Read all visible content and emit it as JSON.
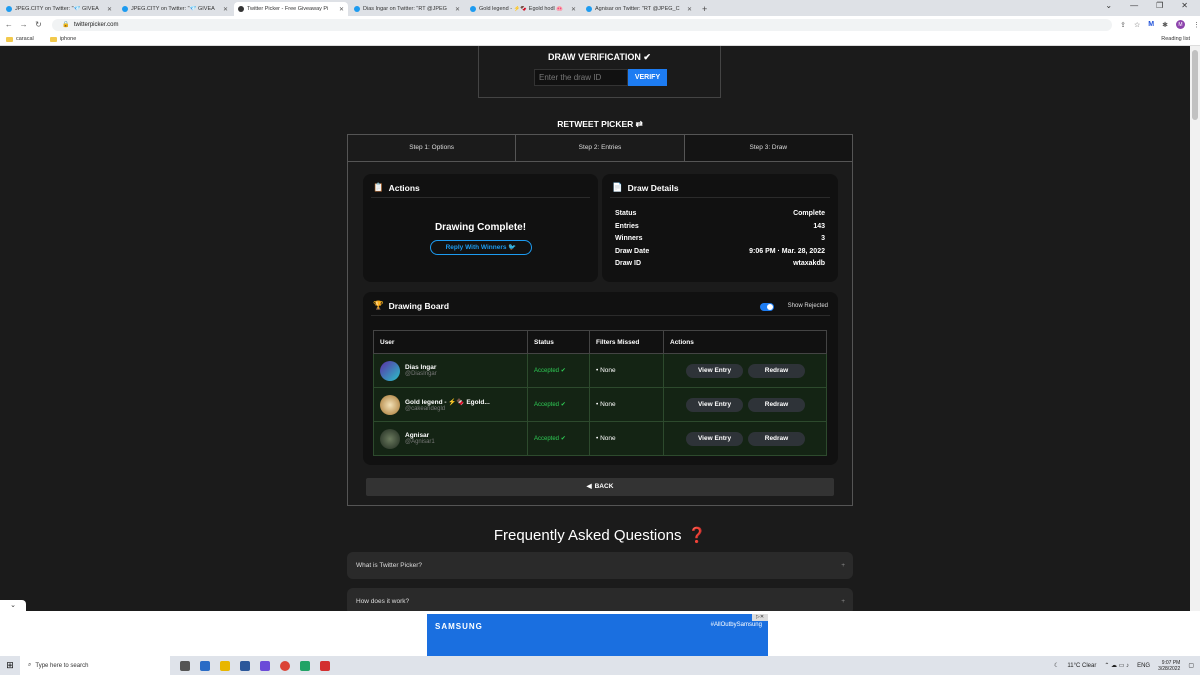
{
  "browser": {
    "tabs": [
      {
        "title": "JPEG.CITY on Twitter: \"💎 GIVEA",
        "active": false
      },
      {
        "title": "JPEG.CITY on Twitter: \"💎 GIVEA",
        "active": false
      },
      {
        "title": "Twitter Picker - Free Giveaway Pi",
        "active": true
      },
      {
        "title": "Dias Ingar on Twitter: \"RT @JPEG",
        "active": false
      },
      {
        "title": "Gold legend - ⚡🍫 Egold hodl 🐽",
        "active": false
      },
      {
        "title": "Agnisar on Twitter: \"RT @JPEG_C",
        "active": false
      }
    ],
    "url": "twitterpicker.com",
    "bookmarks": [
      "caracal",
      "iphone"
    ],
    "reading_list": "Reading list",
    "avatar_letter": "M"
  },
  "verify": {
    "title": "DRAW VERIFICATION",
    "placeholder": "Enter the draw ID",
    "button": "VERIFY"
  },
  "picker": {
    "title": "RETWEET PICKER",
    "steps": [
      "Step 1: Options",
      "Step 2: Entries",
      "Step 3: Draw"
    ]
  },
  "actions": {
    "title": "Actions",
    "status": "Drawing Complete!",
    "reply": "Reply With Winners"
  },
  "details": {
    "title": "Draw Details",
    "rows": [
      {
        "k": "Status",
        "v": "Complete"
      },
      {
        "k": "Entries",
        "v": "143"
      },
      {
        "k": "Winners",
        "v": "3"
      },
      {
        "k": "Draw Date",
        "v": "9:06 PM · Mar. 28, 2022"
      },
      {
        "k": "Draw ID",
        "v": "wtaxakdb"
      }
    ]
  },
  "board": {
    "title": "Drawing Board",
    "toggle": "Show Rejected",
    "headers": [
      "User",
      "Status",
      "Filters Missed",
      "Actions"
    ],
    "rows": [
      {
        "name": "Dias Ingar",
        "handle": "@DiasIngar",
        "status": "Accepted",
        "filters": "• None",
        "b1": "View Entry",
        "b2": "Redraw",
        "color": "#5a2ea6"
      },
      {
        "name": "Gold legend - ⚡🍫 Egold...",
        "handle": "@cakeandegld",
        "status": "Accepted",
        "filters": "• None",
        "b1": "View Entry",
        "b2": "Redraw",
        "color": "#c9a36a"
      },
      {
        "name": "Agnisar",
        "handle": "@Agnisar1",
        "status": "Accepted",
        "filters": "• None",
        "b1": "View Entry",
        "b2": "Redraw",
        "color": "#3a4a3a"
      }
    ]
  },
  "back": "BACK",
  "faq": {
    "title": "Frequently Asked Questions",
    "items": [
      "What is Twitter Picker?",
      "How does it work?"
    ]
  },
  "ad": {
    "brand": "SAMSUNG",
    "tag": "#AllOutbySamsung"
  },
  "taskbar": {
    "search": "Type here to search",
    "weather": "11°C  Clear",
    "lang": "ENG",
    "time": "9:07 PM",
    "date": "3/28/2022"
  }
}
